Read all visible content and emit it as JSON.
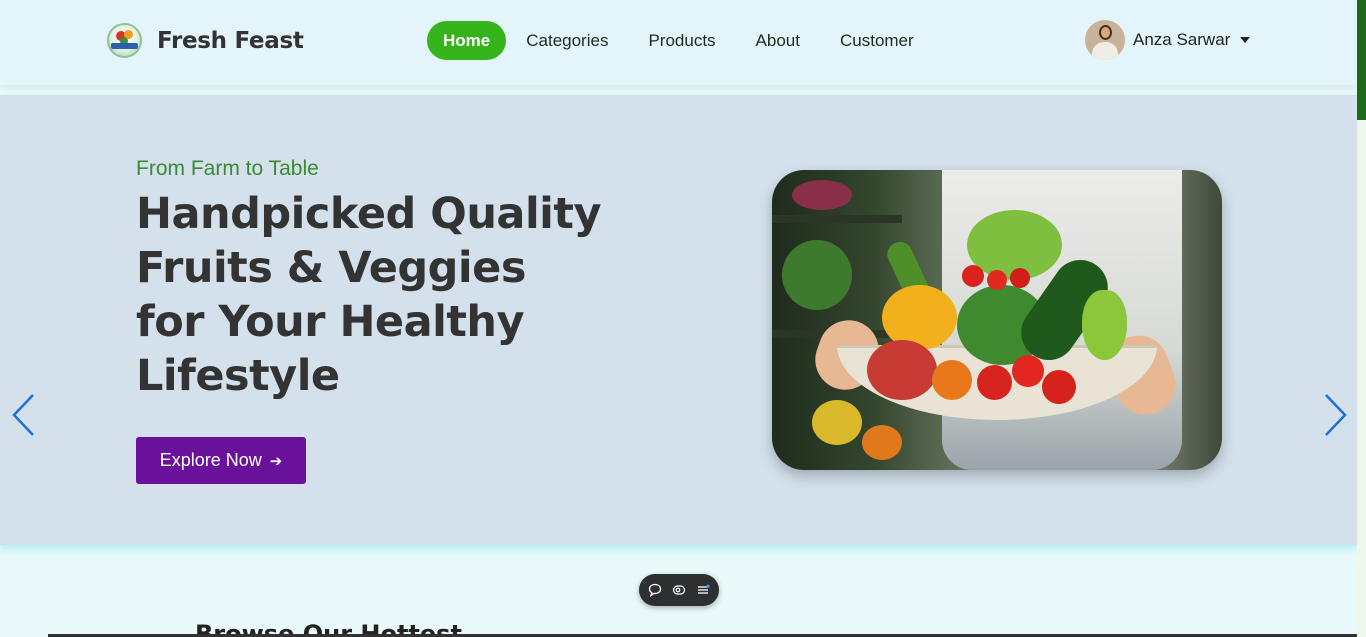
{
  "header": {
    "brand_name": "Fresh Feast",
    "nav": [
      {
        "label": "Home",
        "active": true
      },
      {
        "label": "Categories",
        "active": false
      },
      {
        "label": "Products",
        "active": false
      },
      {
        "label": "About",
        "active": false
      },
      {
        "label": "Customer",
        "active": false
      }
    ],
    "user_name": "Anza Sarwar"
  },
  "hero": {
    "tagline": "From Farm to Table",
    "headline_lines": [
      "Handpicked Quality",
      "Fruits & Veggies",
      "for Your Healthy",
      "Lifestyle"
    ],
    "cta_label": "Explore Now",
    "cta_arrow": "➔"
  },
  "section": {
    "title": "Browse Our Hottest"
  },
  "colors": {
    "accent_green": "#35b41c",
    "tagline_green": "#3a8a32",
    "cta_purple": "#6a119c",
    "carousel_arrow": "#1a73d9",
    "scroll_thumb": "#1d6a1d"
  },
  "icons": {
    "prev": "chevron-left-icon",
    "next": "chevron-right-icon",
    "toolbar": [
      "comment-icon",
      "eye-icon",
      "menu-icon"
    ]
  }
}
